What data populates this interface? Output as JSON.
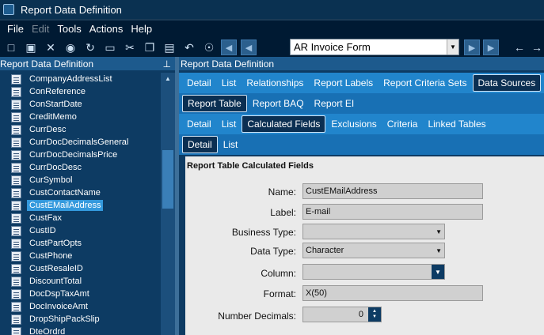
{
  "window": {
    "title": "Report Data Definition"
  },
  "menu": [
    "File",
    "Edit",
    "Tools",
    "Actions",
    "Help"
  ],
  "toolbar": {
    "document_value": "AR Invoice Form"
  },
  "left_panel": {
    "header": "Report Data Definition",
    "pin_icon": "pin-icon",
    "items": [
      {
        "label": "CompanyAddressList",
        "selected": false
      },
      {
        "label": "ConReference",
        "selected": false
      },
      {
        "label": "ConStartDate",
        "selected": false
      },
      {
        "label": "CreditMemo",
        "selected": false
      },
      {
        "label": "CurrDesc",
        "selected": false
      },
      {
        "label": "CurrDocDecimalsGeneral",
        "selected": false
      },
      {
        "label": "CurrDocDecimalsPrice",
        "selected": false
      },
      {
        "label": "CurrDocDesc",
        "selected": false
      },
      {
        "label": "CurSymbol",
        "selected": false
      },
      {
        "label": "CustContactName",
        "selected": false
      },
      {
        "label": "CustEMailAddress",
        "selected": true
      },
      {
        "label": "CustFax",
        "selected": false
      },
      {
        "label": "CustID",
        "selected": false
      },
      {
        "label": "CustPartOpts",
        "selected": false
      },
      {
        "label": "CustPhone",
        "selected": false
      },
      {
        "label": "CustResaleID",
        "selected": false
      },
      {
        "label": "DiscountTotal",
        "selected": false
      },
      {
        "label": "DocDspTaxAmt",
        "selected": false
      },
      {
        "label": "DocInvoiceAmt",
        "selected": false
      },
      {
        "label": "DropShipPackSlip",
        "selected": false
      },
      {
        "label": "DteOrdrd",
        "selected": false
      }
    ]
  },
  "right_panel": {
    "header": "Report Data Definition",
    "tabs_row1": [
      "Detail",
      "List",
      "Relationships",
      "Report Labels",
      "Report Criteria Sets",
      "Data Sources"
    ],
    "tabs_row1_active": 5,
    "tabs_row2": [
      "Report Table",
      "Report BAQ",
      "Report EI"
    ],
    "tabs_row2_active": 0,
    "tabs_row3": [
      "Detail",
      "List",
      "Calculated Fields",
      "Exclusions",
      "Criteria",
      "Linked Tables"
    ],
    "tabs_row3_active": 2,
    "tabs_row4": [
      "Detail",
      "List"
    ],
    "tabs_row4_active": 0,
    "section_title": "Report Table Calculated Fields",
    "fields": {
      "name_label": "Name:",
      "name_value": "CustEMailAddress",
      "label_label": "Label:",
      "label_value": "E-mail",
      "business_type_label": "Business Type:",
      "business_type_value": "",
      "data_type_label": "Data Type:",
      "data_type_value": "Character",
      "column_label": "Column:",
      "column_value": "",
      "format_label": "Format:",
      "format_value": "X(50)",
      "decimals_label": "Number Decimals:",
      "decimals_value": "0"
    }
  }
}
